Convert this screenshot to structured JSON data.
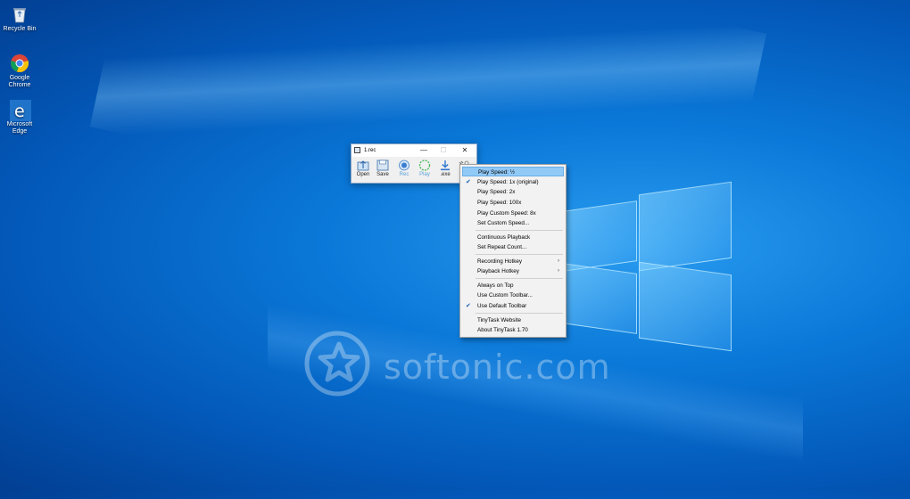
{
  "desktop": {
    "icons": [
      {
        "label": "Recycle Bin"
      },
      {
        "label": "Google Chrome"
      },
      {
        "label": "Microsoft Edge"
      }
    ],
    "watermark": "softonic.com"
  },
  "tinytask": {
    "title": "1.rec",
    "controls": {
      "minimize": "—",
      "maximize": "☐",
      "close": "✕"
    },
    "toolbar": [
      {
        "label": "Open",
        "icon": "open-icon"
      },
      {
        "label": "Save",
        "icon": "save-icon"
      },
      {
        "label": "Rec",
        "icon": "record-icon"
      },
      {
        "label": "Play",
        "icon": "play-icon"
      },
      {
        "label": ".exe",
        "icon": "download-icon"
      },
      {
        "label": "P",
        "icon": "prefs-icon"
      }
    ]
  },
  "menu": {
    "items": [
      {
        "label": "Play Speed:  ½",
        "checked": "",
        "highlighted": true
      },
      {
        "label": "Play Speed:  1x (original)",
        "checked": "✔"
      },
      {
        "label": "Play Speed:  2x",
        "checked": ""
      },
      {
        "label": "Play Speed:  100x",
        "checked": ""
      },
      {
        "label": "Play Custom Speed:  8x",
        "checked": ""
      },
      {
        "label": "Set Custom Speed...",
        "checked": ""
      },
      {
        "label": "Continuous Playback",
        "checked": ""
      },
      {
        "label": "Set Repeat Count...",
        "checked": ""
      },
      {
        "label": "Recording Hotkey",
        "checked": "",
        "submenu": "›"
      },
      {
        "label": "Playback Hotkey",
        "checked": "",
        "submenu": "›"
      },
      {
        "label": "Always on Top",
        "checked": ""
      },
      {
        "label": "Use Custom Toolbar...",
        "checked": ""
      },
      {
        "label": "Use Default Toolbar",
        "checked": "✔"
      },
      {
        "label": "TinyTask Website",
        "checked": ""
      },
      {
        "label": "About TinyTask 1.70",
        "checked": ""
      }
    ]
  },
  "colors": {
    "desktop_blue": "#0a78d8",
    "menu_highlight": "#91c9f7",
    "check_blue": "#1a5fb4"
  }
}
